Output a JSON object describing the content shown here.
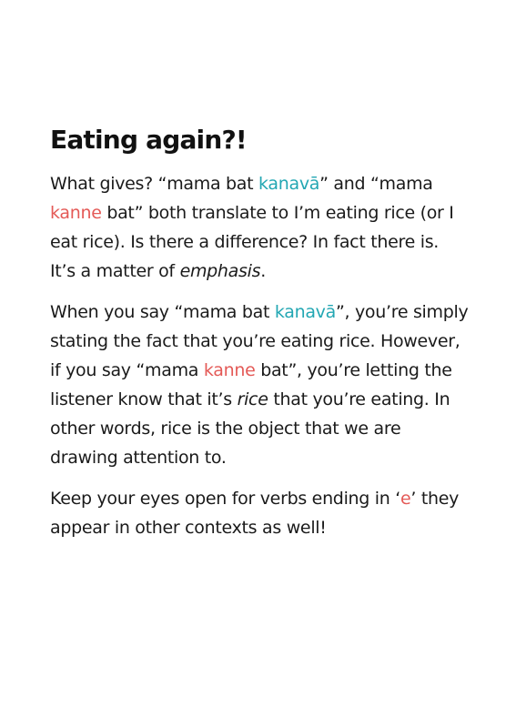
{
  "heading": "Eating again?!",
  "p1": {
    "a": "What gives? “mama bat ",
    "kanava": "kanavā",
    "b": "” and “mama ",
    "kanne": "kanne",
    "c": " bat” both translate to I’m eating rice (or I eat rice). Is there a difference? In fact there is. It’s a matter of ",
    "emphasis": "emphasis",
    "d": "."
  },
  "p2": {
    "a": "When you say “mama bat ",
    "kanava": "kanavā",
    "b": "”, you’re simply stating the fact that you’re eating rice. However, if you say “mama ",
    "kanne": "kanne",
    "c": " bat”, you’re letting the listener know that it’s ",
    "rice": "rice",
    "d": " that you’re eating. In other words, rice is the object that we are drawing attention to."
  },
  "p3": {
    "a": "Keep your eyes open for verbs ending in ‘",
    "e": "e",
    "b": "’ they appear in other contexts as well!"
  },
  "colors": {
    "teal": "#23a7b3",
    "red": "#e45a57",
    "text": "#1a1a1a"
  }
}
